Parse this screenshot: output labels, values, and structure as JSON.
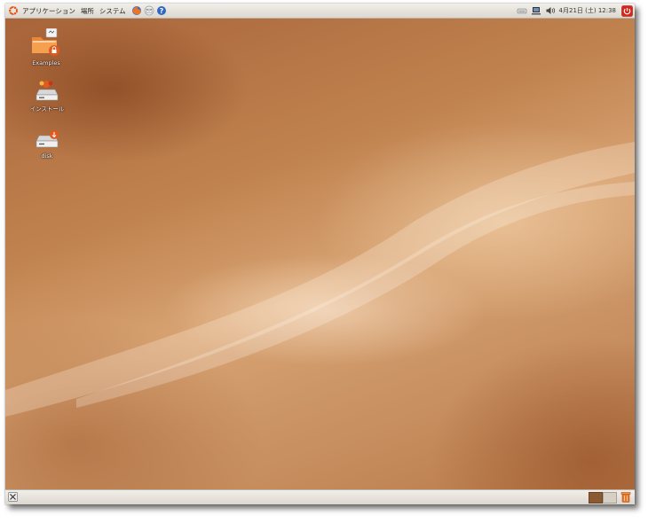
{
  "top_panel": {
    "menus": [
      "アプリケーション",
      "場所",
      "システム"
    ],
    "launchers": [
      "firefox-icon",
      "mail-icon",
      "help-icon"
    ],
    "tray_icons": [
      "keyboard-icon",
      "network-icon",
      "volume-icon"
    ],
    "clock": "4月21日 (土) 12:38",
    "power_icon": "power-icon"
  },
  "desktop": {
    "icons": [
      {
        "label": "Examples",
        "icon": "folder-icon"
      },
      {
        "label": "インストール",
        "icon": "install-icon"
      },
      {
        "label": "disk",
        "icon": "drive-icon"
      }
    ]
  },
  "bottom_panel": {
    "show_desktop_icon": "show-desktop-icon",
    "workspaces": [
      "workspace-1",
      "workspace-2"
    ],
    "trash_icon": "trash-icon"
  },
  "colors": {
    "accent": "#e05a1e",
    "panel": "#e8e4dd",
    "wallpaper": "#c0834f"
  }
}
